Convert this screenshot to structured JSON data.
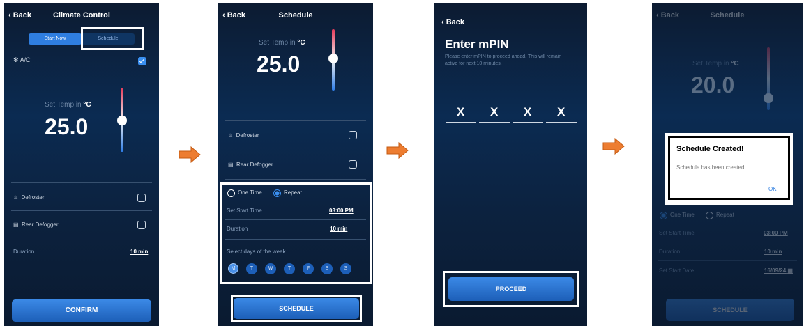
{
  "screen1": {
    "back": "Back",
    "title": "Climate Control",
    "tab_start_now": "Start Now",
    "tab_schedule": "Schedule",
    "ac_label": "A/C",
    "set_temp_label": "Set Temp in",
    "temp_unit": "°C",
    "temp_value": "25.0",
    "defroster_label": "Defroster",
    "rear_defogger_label": "Rear Defogger",
    "duration_label": "Duration",
    "duration_value": "10 min",
    "confirm_label": "CONFIRM"
  },
  "screen2": {
    "back": "Back",
    "title": "Schedule",
    "set_temp_label": "Set Temp in",
    "temp_unit": "°C",
    "temp_value": "25.0",
    "defroster_label": "Defroster",
    "rear_defogger_label": "Rear Defogger",
    "one_time_label": "One Time",
    "repeat_label": "Repeat",
    "start_time_label": "Set Start Time",
    "start_time_value": "03:00 PM",
    "duration_label": "Duration",
    "duration_value": "10 min",
    "days_label": "Select days of the week",
    "days": [
      "M",
      "T",
      "W",
      "T",
      "F",
      "S",
      "S"
    ],
    "schedule_label": "SCHEDULE"
  },
  "screen3": {
    "back": "Back",
    "heading": "Enter mPIN",
    "description": "Please enter mPIN to proceed ahead. This will remain active for next 10 minutes.",
    "pin_digits": [
      "X",
      "X",
      "X",
      "X"
    ],
    "proceed_label": "PROCEED"
  },
  "screen4": {
    "back": "Back",
    "title": "Schedule",
    "set_temp_label": "Set Temp in",
    "temp_unit": "°C",
    "temp_value": "20.0",
    "one_time_label": "One Time",
    "repeat_label": "Repeat",
    "start_time_label": "Set Start Time",
    "start_time_value": "03:00 PM",
    "duration_label": "Duration",
    "duration_value": "10 min",
    "start_date_label": "Set Start Date",
    "start_date_value": "16/09/24",
    "schedule_label": "SCHEDULE",
    "dialog": {
      "title": "Schedule Created!",
      "message": "Schedule has been created.",
      "ok_label": "OK"
    }
  },
  "colors": {
    "accent": "#3a8ff0",
    "arrow": "#ed7d31",
    "background": "#0b2b52"
  }
}
